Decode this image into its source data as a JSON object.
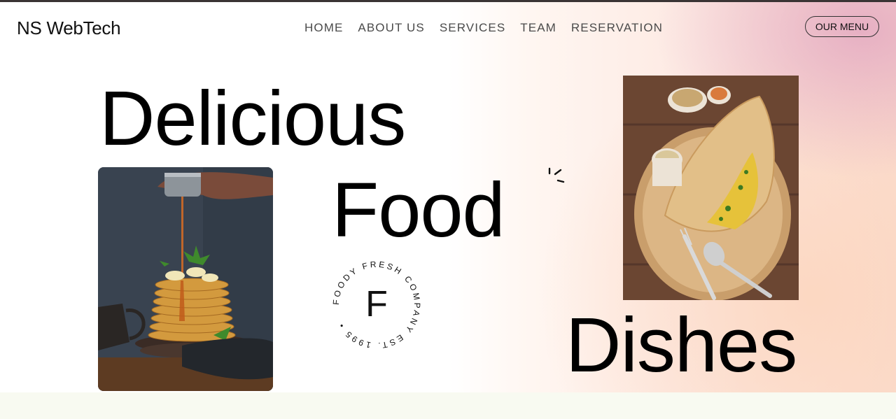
{
  "brand": {
    "name": "NS WebTech"
  },
  "nav": {
    "items": [
      {
        "label": "HOME"
      },
      {
        "label": "ABOUT US"
      },
      {
        "label": "SERVICES"
      },
      {
        "label": "TEAM"
      },
      {
        "label": "RESERVATION"
      }
    ],
    "menu_button": "OUR MENU"
  },
  "hero": {
    "word1": "Delicious",
    "word2": "Food",
    "word3": "Dishes",
    "badge": {
      "letter": "F",
      "ring_text": "FOODY FRESH COMPANY EST. 1995 •"
    },
    "images": {
      "left": "pancake-stack-photo",
      "right": "dosa-plate-photo"
    },
    "decoration": "sparkle-icon"
  },
  "colors": {
    "text": "#000000",
    "nav_text": "#4a4a4a",
    "top_line": "#3a3434",
    "gradient_pink": "#e0a0be",
    "gradient_peach": "#fcd6be",
    "bottom_band": "#f8faf1"
  }
}
